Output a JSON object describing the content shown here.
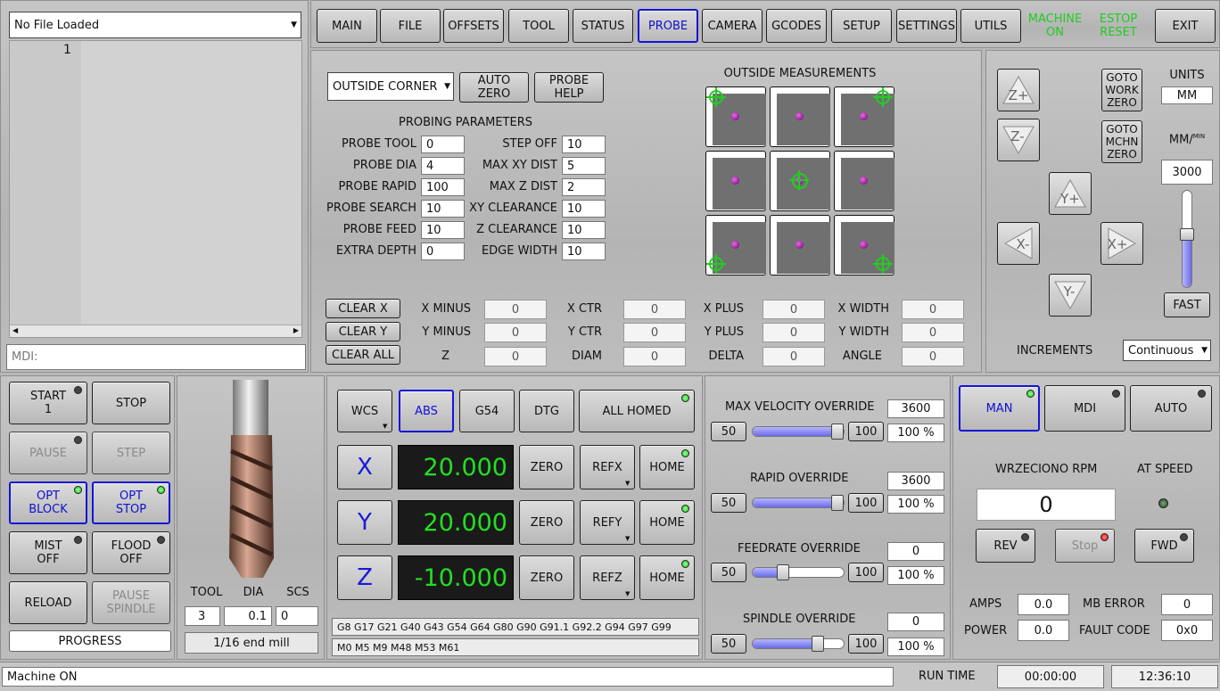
{
  "file": {
    "dropdown": "No File Loaded",
    "line_number": "1",
    "mdi_placeholder": "MDI:"
  },
  "tabs": [
    "MAIN",
    "FILE",
    "OFFSETS",
    "TOOL",
    "STATUS",
    "PROBE",
    "CAMERA",
    "GCODES",
    "SETUP",
    "SETTINGS",
    "UTILS"
  ],
  "active_tab": "PROBE",
  "status_buttons": {
    "machine": "MACHINE\nON",
    "estop": "ESTOP\nRESET",
    "exit": "EXIT"
  },
  "probe": {
    "mode": "OUTSIDE CORNERS",
    "auto_zero": "AUTO\nZERO",
    "probe_help": "PROBE\nHELP",
    "params_title": "PROBING PARAMETERS",
    "left_params": [
      {
        "label": "PROBE TOOL",
        "value": "0"
      },
      {
        "label": "PROBE DIA",
        "value": "4"
      },
      {
        "label": "PROBE RAPID",
        "value": "100"
      },
      {
        "label": "PROBE SEARCH",
        "value": "10"
      },
      {
        "label": "PROBE FEED",
        "value": "10"
      },
      {
        "label": "EXTRA DEPTH",
        "value": "0"
      }
    ],
    "right_params": [
      {
        "label": "STEP OFF",
        "value": "10"
      },
      {
        "label": "MAX XY DIST",
        "value": "5"
      },
      {
        "label": "MAX Z DIST",
        "value": "2"
      },
      {
        "label": "XY CLEARANCE",
        "value": "10"
      },
      {
        "label": "Z CLEARANCE",
        "value": "10"
      },
      {
        "label": "EDGE WIDTH",
        "value": "10"
      }
    ],
    "measure_title": "OUTSIDE MEASUREMENTS",
    "clear_buttons": [
      "CLEAR X",
      "CLEAR Y",
      "CLEAR ALL"
    ],
    "results": [
      [
        {
          "label": "X MINUS",
          "value": "0"
        },
        {
          "label": "X CTR",
          "value": "0"
        },
        {
          "label": "X PLUS",
          "value": "0"
        },
        {
          "label": "X WIDTH",
          "value": "0"
        }
      ],
      [
        {
          "label": "Y MINUS",
          "value": "0"
        },
        {
          "label": "Y CTR",
          "value": "0"
        },
        {
          "label": "Y PLUS",
          "value": "0"
        },
        {
          "label": "Y WIDTH",
          "value": "0"
        }
      ],
      [
        {
          "label": "Z",
          "value": "0"
        },
        {
          "label": "DIAM",
          "value": "0"
        },
        {
          "label": "DELTA",
          "value": "0"
        },
        {
          "label": "ANGLE",
          "value": "0"
        }
      ]
    ]
  },
  "jog": {
    "goto_work_zero": "GOTO\nWORK\nZERO",
    "goto_mchn_zero": "GOTO\nMCHN\nZERO",
    "units_label": "UNITS",
    "units_value": "MM",
    "rate_label": "MM/",
    "rate_sup": "MIN",
    "rate_value": "3000",
    "fast": "FAST",
    "increments_label": "INCREMENTS",
    "increments_value": "Continuous",
    "buttons": [
      "Z+",
      "Z-",
      "Y+",
      "X-",
      "X+",
      "Y-"
    ],
    "rate_level": 0.55
  },
  "control": {
    "start": "START\n1",
    "stop": "STOP",
    "pause": "PAUSE",
    "step": "STEP",
    "opt_block": "OPT\nBLOCK",
    "opt_stop": "OPT\nSTOP",
    "mist": "MIST\nOFF",
    "flood": "FLOOD\nOFF",
    "reload": "RELOAD",
    "pause_spindle": "PAUSE\nSPINDLE",
    "progress": "PROGRESS"
  },
  "tool": {
    "headers": [
      "TOOL",
      "DIA",
      "SCS"
    ],
    "values": [
      "3",
      "0.1",
      "0"
    ],
    "description": "1/16 end mill"
  },
  "dro": {
    "wcs": "WCS",
    "abs": "ABS",
    "g54": "G54",
    "dtg": "DTG",
    "all_homed": "ALL HOMED",
    "axes": [
      {
        "axis": "X",
        "value": "20.000",
        "zero": "ZERO",
        "ref": "REFX",
        "home": "HOME"
      },
      {
        "axis": "Y",
        "value": "20.000",
        "zero": "ZERO",
        "ref": "REFY",
        "home": "HOME"
      },
      {
        "axis": "Z",
        "value": "-10.000",
        "zero": "ZERO",
        "ref": "REFZ",
        "home": "HOME"
      }
    ],
    "gcodes": "G8 G17 G21 G40 G43 G54 G64 G80 G90 G91.1 G92.2 G94 G97 G99",
    "mcodes": "M0 M5 M9 M48 M53 M61"
  },
  "overrides": [
    {
      "title": "MAX VELOCITY OVERRIDE",
      "value": "3600",
      "min": "50",
      "max": "100",
      "percent": "100 %",
      "level": 1.0
    },
    {
      "title": "RAPID OVERRIDE",
      "value": "3600",
      "min": "50",
      "max": "100",
      "percent": "100 %",
      "level": 1.0
    },
    {
      "title": "FEEDRATE OVERRIDE",
      "value": "0",
      "min": "50",
      "max": "100",
      "percent": "100 %",
      "level": 0.33
    },
    {
      "title": "SPINDLE OVERRIDE",
      "value": "0",
      "min": "50",
      "max": "100",
      "percent": "100 %",
      "level": 0.72
    }
  ],
  "spindle": {
    "modes": [
      "MAN",
      "MDI",
      "AUTO"
    ],
    "rpm_label": "WRZECIONO RPM",
    "at_speed": "AT SPEED",
    "rpm": "0",
    "rev": "REV",
    "stop": "Stop",
    "fwd": "FWD",
    "amps_label": "AMPS",
    "amps": "0.0",
    "power_label": "POWER",
    "power": "0.0",
    "mb_error_label": "MB ERROR",
    "mb_error": "0",
    "fault_label": "FAULT CODE",
    "fault": "0x0"
  },
  "statusbar": {
    "message": "Machine ON",
    "run_time_label": "RUN TIME",
    "run_time": "00:00:00",
    "clock": "12:36:10"
  }
}
